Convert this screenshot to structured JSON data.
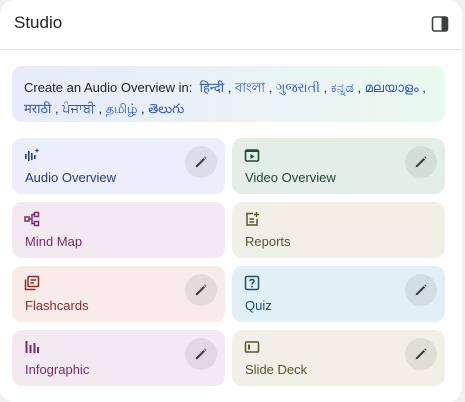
{
  "header": {
    "title": "Studio"
  },
  "banner": {
    "prefix": "Create an Audio Overview in:",
    "languages": [
      "हिन्दी",
      "বাংলা",
      "ગુજરાતી",
      "ಕನ್ನಡ",
      "മലയാളം",
      "मराठी",
      "ਪੰਜਾਬੀ",
      "தமிழ்",
      "తెలుగు"
    ],
    "separator": ","
  },
  "cards": [
    {
      "label": "Audio Overview",
      "icon": "audio-waveform-icon",
      "bg": "#eceefc",
      "color": "#263d80",
      "editable": true
    },
    {
      "label": "Video Overview",
      "icon": "video-play-icon",
      "bg": "#e3efe6",
      "color": "#1e4b2c",
      "editable": true
    },
    {
      "label": "Mind Map",
      "icon": "mind-map-icon",
      "bg": "#f3eaf1",
      "color": "#7a2a68",
      "editable": false
    },
    {
      "label": "Reports",
      "icon": "reports-icon",
      "bg": "#f2f0e6",
      "color": "#5e5329",
      "editable": false
    },
    {
      "label": "Flashcards",
      "icon": "flashcards-icon",
      "bg": "#f8ebe9",
      "color": "#8a2e28",
      "editable": true
    },
    {
      "label": "Quiz",
      "icon": "quiz-icon",
      "bg": "#e1f0f7",
      "color": "#1d4f6b",
      "editable": true
    },
    {
      "label": "Infographic",
      "icon": "infographic-icon",
      "bg": "#f3eaf1",
      "color": "#7a2a68",
      "editable": true
    },
    {
      "label": "Slide Deck",
      "icon": "slide-deck-icon",
      "bg": "#f2f0e6",
      "color": "#5e5329",
      "editable": true
    }
  ]
}
